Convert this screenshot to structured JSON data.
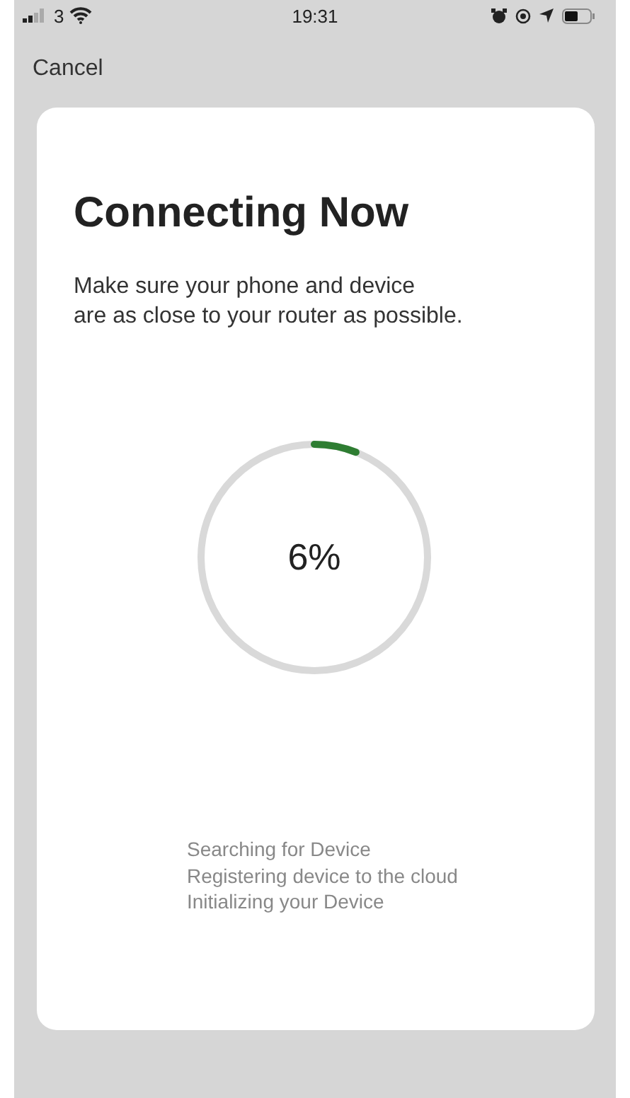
{
  "status_bar": {
    "carrier": "3",
    "time": "19:31"
  },
  "nav": {
    "cancel": "Cancel"
  },
  "title": "Connecting Now",
  "instruction": "Make sure your phone and device\n are as close to your router as possible.",
  "progress": {
    "level": 0.06,
    "reading": "6%"
  },
  "steps": [
    "Searching for Device",
    "Registering device to the cloud",
    "Initializing your Device"
  ]
}
